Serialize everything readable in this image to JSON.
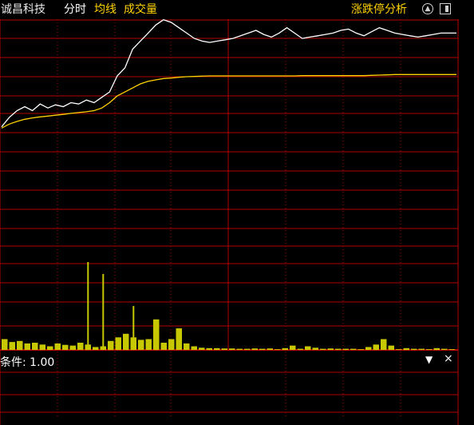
{
  "header": {
    "stock_name": "诚昌科技",
    "tabs": [
      "分时",
      "均线",
      "成交量"
    ],
    "right_link": "涨跌停分析",
    "icons": [
      "upload-icon",
      "window-icon"
    ]
  },
  "indicator": {
    "label": "条件: 1.00",
    "dropdown_icon": "▼",
    "close_icon": "×"
  },
  "colors": {
    "grid": "#b40000",
    "price_line": "#ffffff",
    "avg_line": "#ffd200",
    "volume": "#c8c800",
    "text_accent": "#ffd200"
  },
  "chart_data": {
    "type": "line",
    "x": [
      0,
      1,
      2,
      3,
      4,
      5,
      6,
      7,
      8,
      9,
      10,
      11,
      12,
      13,
      14,
      15,
      16,
      17,
      18,
      19,
      20,
      21,
      22,
      23,
      24,
      25,
      26,
      27,
      28,
      29,
      30,
      31,
      32,
      33,
      34,
      35,
      36,
      37,
      38,
      39,
      40,
      41,
      42,
      43,
      44,
      45,
      46,
      47,
      48,
      49,
      50,
      51,
      52,
      53,
      54,
      55,
      56,
      57,
      58,
      59
    ],
    "series": [
      {
        "values": [
          10,
          45,
          70,
          85,
          70,
          95,
          80,
          92,
          85,
          100,
          95,
          110,
          100,
          120,
          140,
          200,
          230,
          300,
          330,
          360,
          390,
          410,
          400,
          380,
          360,
          340,
          330,
          325,
          330,
          335,
          340,
          350,
          360,
          370,
          355,
          345,
          360,
          380,
          360,
          340,
          345,
          350,
          355,
          360,
          370,
          375,
          360,
          350,
          365,
          380,
          370,
          360,
          355,
          350,
          345,
          350,
          355,
          360,
          360,
          360
        ]
      },
      {
        "values": [
          5,
          20,
          30,
          38,
          43,
          47,
          50,
          53,
          56,
          60,
          63,
          66,
          70,
          80,
          100,
          125,
          140,
          155,
          170,
          180,
          185,
          190,
          192,
          195,
          197,
          198,
          199,
          200,
          200,
          200,
          200,
          200,
          200,
          200,
          200,
          200,
          200,
          200,
          200,
          201,
          201,
          201,
          201,
          201,
          201,
          201,
          201,
          201,
          202,
          203,
          204,
          205,
          205,
          205,
          205,
          205,
          205,
          205,
          205,
          205
        ]
      }
    ],
    "volume": {
      "values": [
        30,
        22,
        25,
        18,
        20,
        15,
        10,
        18,
        14,
        12,
        20,
        15,
        8,
        10,
        25,
        35,
        45,
        35,
        28,
        30,
        85,
        20,
        30,
        60,
        18,
        10,
        6,
        5,
        5,
        4,
        4,
        3,
        3,
        4,
        3,
        4,
        2,
        5,
        12,
        3,
        10,
        6,
        3,
        4,
        3,
        3,
        3,
        2,
        8,
        15,
        30,
        12,
        2,
        5,
        3,
        3,
        2,
        5,
        3,
        2
      ],
      "spikes": [
        0,
        0,
        0,
        0,
        0,
        0,
        0,
        0,
        0,
        0,
        0,
        110,
        0,
        95,
        0,
        0,
        0,
        55,
        0,
        0,
        0,
        0,
        0,
        0,
        0,
        0,
        0,
        0,
        0,
        0,
        0,
        0,
        0,
        0,
        0,
        0,
        0,
        0,
        0,
        0,
        0,
        0,
        0,
        0,
        0,
        0,
        0,
        0,
        0,
        0,
        0,
        0,
        0,
        0,
        0,
        0,
        0,
        0,
        0,
        0
      ]
    }
  }
}
